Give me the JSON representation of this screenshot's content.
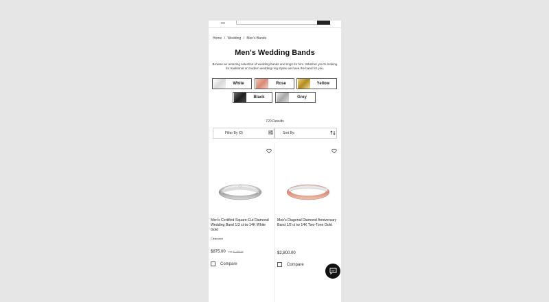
{
  "breadcrumb": [
    "Home",
    "/",
    "Wedding",
    "/",
    "Men's Bands"
  ],
  "page_title": "Men's Wedding Bands",
  "intro_text": "Browse an amazing selection of wedding bands and rings for him. Whether you're looking for traditional or modern wedding ring styles we have the band for you.",
  "metal_filters": [
    {
      "label": "White",
      "color": "#e8e8e8"
    },
    {
      "label": "Rose",
      "color": "#e0a08e"
    },
    {
      "label": "Yellow",
      "color": "#d4b04a"
    },
    {
      "label": "Black",
      "color": "#333333"
    },
    {
      "label": "Grey",
      "color": "#c0c0c0"
    }
  ],
  "results_count": "720 Results",
  "filter_label": "Filter By (0)",
  "sort_label": "Sort By:",
  "products": [
    {
      "name": "Men's Certified Square-Cut Diamond Wedding Band 1/3 ct tw 14K White Gold",
      "badge": "Clearance",
      "price": "$875.00",
      "was_prefix": "was",
      "was_price": "$1,450.00",
      "compare_label": "Compare"
    },
    {
      "name": "Men's Diagonal Diamond Anniversary Band 1/2 ct tw 14K Two-Tone Gold",
      "badge": "",
      "price": "$2,800.00",
      "compare_label": "Compare"
    }
  ],
  "icons": {
    "wishlist": "heart-icon",
    "filter": "sliders-icon",
    "sort": "sort-arrows-icon",
    "chat": "chat-icon"
  }
}
